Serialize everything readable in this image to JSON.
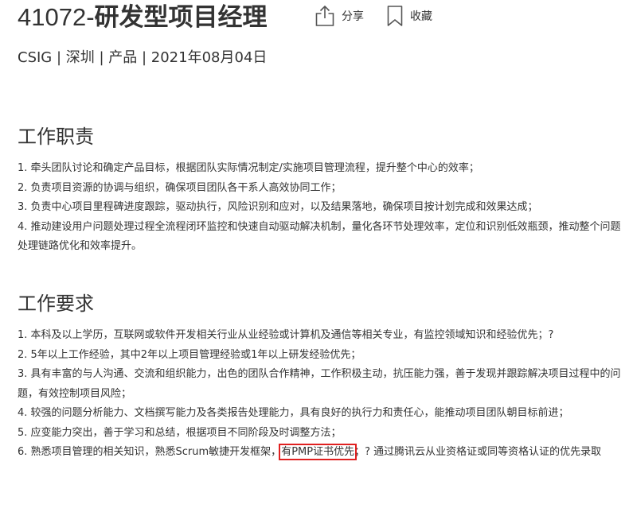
{
  "job": {
    "code": "41072-",
    "name": "研发型项目经理",
    "meta": "CSIG | 深圳 | 产品 | 2021年08月04日"
  },
  "actions": {
    "share_label": "分享",
    "favorite_label": "收藏"
  },
  "duties": {
    "heading": "工作职责",
    "items": [
      "1. 牵头团队讨论和确定产品目标，根据团队实际情况制定/实施项目管理流程，提升整个中心的效率；",
      "2. 负责项目资源的协调与组织，确保项目团队各干系人高效协同工作；",
      "3. 负责中心项目里程碑进度跟踪，驱动执行，风险识别和应对，以及结果落地，确保项目按计划完成和效果达成；",
      "4. 推动建设用户问题处理过程全流程闭环监控和快速自动驱动解决机制，量化各环节处理效率，定位和识别低效瓶颈，推动整个问题处理链路优化和效率提升。"
    ]
  },
  "requirements": {
    "heading": "工作要求",
    "items": [
      "1. 本科及以上学历，互联网或软件开发相关行业从业经验或计算机及通信等相关专业，有监控领域知识和经验优先；?",
      "2. 5年以上工作经验，其中2年以上项目管理经验或1年以上研发经验优先；",
      "3. 具有丰富的与人沟通、交流和组织能力，出色的团队合作精神，工作积极主动，抗压能力强，善于发现并跟踪解决项目过程中的问题，有效控制项目风险；",
      "4. 较强的问题分析能力、文档撰写能力及各类报告处理能力，具有良好的执行力和责任心，能推动项目团队朝目标前进；",
      "5. 应变能力突出，善于学习和总结，根据项目不同阶段及时调整方法；"
    ],
    "item6_before": "6. 熟悉项目管理的相关知识，熟悉Scrum敏捷开发框架，",
    "item6_highlight": "有PMP证书优先",
    "item6_after": "；? 通过腾讯云从业资格证或同等资格认证的优先录取"
  },
  "colors": {
    "text": "#333333",
    "highlight_border": "#e02020"
  }
}
